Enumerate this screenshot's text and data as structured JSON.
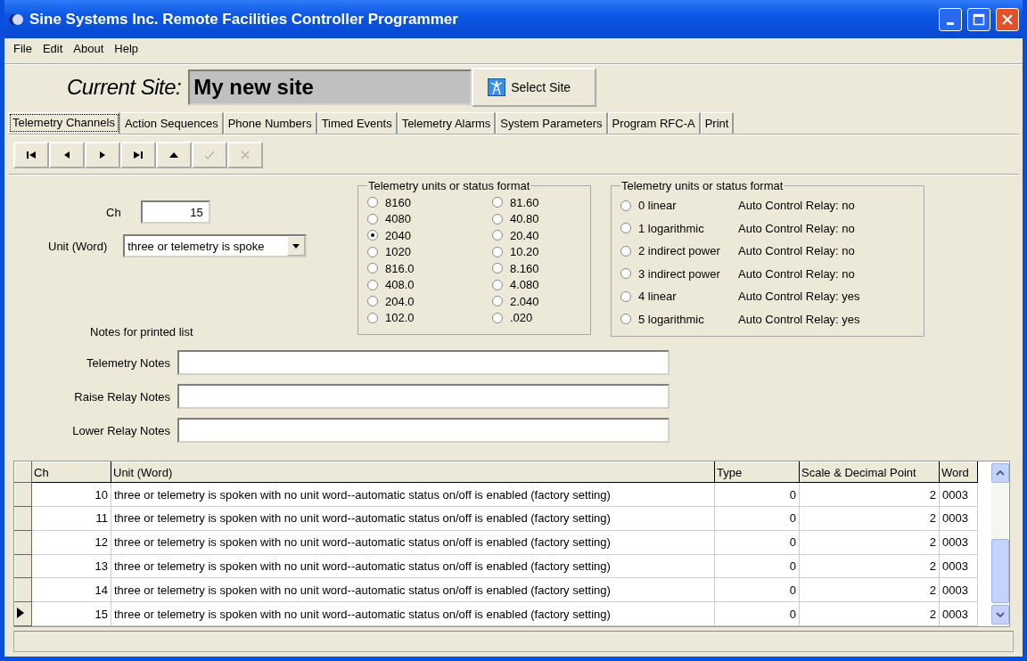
{
  "window": {
    "title": "Sine Systems Inc. Remote Facilities Controller Programmer"
  },
  "menu": [
    "File",
    "Edit",
    "About",
    "Help"
  ],
  "site": {
    "label": "Current Site:",
    "value": "My new site",
    "button": "Select Site"
  },
  "tabs": [
    {
      "label": "Telemetry Channels",
      "selected": true
    },
    {
      "label": "Action Sequences",
      "selected": false
    },
    {
      "label": "Phone Numbers",
      "selected": false
    },
    {
      "label": "Timed Events",
      "selected": false
    },
    {
      "label": "Telemetry Alarms",
      "selected": false
    },
    {
      "label": "System Parameters",
      "selected": false
    },
    {
      "label": "Program RFC-A",
      "selected": false
    },
    {
      "label": "Print",
      "selected": false
    }
  ],
  "toolbar": [
    {
      "kind": "first",
      "disabled": false
    },
    {
      "kind": "prev",
      "disabled": false
    },
    {
      "kind": "next",
      "disabled": false
    },
    {
      "kind": "last",
      "disabled": false
    },
    {
      "kind": "up",
      "disabled": false
    },
    {
      "kind": "post",
      "disabled": true
    },
    {
      "kind": "cancel",
      "disabled": true
    }
  ],
  "form": {
    "ch_label": "Ch",
    "ch_value": "15",
    "unit_label": "Unit (Word)",
    "unit_value": "three or telemetry is spoke",
    "notes_heading": "Notes for printed list",
    "notes": [
      {
        "label": "Telemetry Notes"
      },
      {
        "label": "Raise Relay Notes"
      },
      {
        "label": "Lower Relay Notes"
      }
    ]
  },
  "scale_group": {
    "title": "Telemetry units or status format",
    "options": [
      {
        "label": "8160",
        "selected": false
      },
      {
        "label": "4080",
        "selected": false
      },
      {
        "label": "2040",
        "selected": true
      },
      {
        "label": "1020",
        "selected": false
      },
      {
        "label": "816.0",
        "selected": false
      },
      {
        "label": "408.0",
        "selected": false
      },
      {
        "label": "204.0",
        "selected": false
      },
      {
        "label": "102.0",
        "selected": false
      },
      {
        "label": "81.60",
        "selected": false
      },
      {
        "label": "40.80",
        "selected": false
      },
      {
        "label": "20.40",
        "selected": false
      },
      {
        "label": "10.20",
        "selected": false
      },
      {
        "label": "8.160",
        "selected": false
      },
      {
        "label": "4.080",
        "selected": false
      },
      {
        "label": "2.040",
        "selected": false
      },
      {
        "label": ".020",
        "selected": false
      }
    ]
  },
  "type_group": {
    "title": "Telemetry units or status format",
    "options": [
      {
        "label": "0 linear",
        "relay": "Auto Control Relay:  no",
        "selected": false
      },
      {
        "label": "1 logarithmic",
        "relay": "Auto Control Relay:  no",
        "selected": false
      },
      {
        "label": "2 indirect power",
        "relay": "Auto Control Relay:  no",
        "selected": false
      },
      {
        "label": "3 indirect power",
        "relay": "Auto Control Relay:  no",
        "selected": false
      },
      {
        "label": "4 linear",
        "relay": "Auto Control Relay:  yes",
        "selected": false
      },
      {
        "label": "5 logarithmic",
        "relay": "Auto Control Relay:  yes",
        "selected": false
      }
    ]
  },
  "table": {
    "columns": [
      "Ch",
      "Unit (Word)",
      "Type",
      "Scale & Decimal Point",
      "Word"
    ],
    "rows": [
      {
        "cells": [
          "10",
          "three or telemetry is spoken with no unit word--automatic status on/off is enabled (factory setting)",
          "0",
          "2",
          "0003"
        ],
        "selected": false
      },
      {
        "cells": [
          "11",
          "three or telemetry is spoken with no unit word--automatic status on/off is enabled (factory setting)",
          "0",
          "2",
          "0003"
        ],
        "selected": false
      },
      {
        "cells": [
          "12",
          "three or telemetry is spoken with no unit word--automatic status on/off is enabled (factory setting)",
          "0",
          "2",
          "0003"
        ],
        "selected": false
      },
      {
        "cells": [
          "13",
          "three or telemetry is spoken with no unit word--automatic status on/off is enabled (factory setting)",
          "0",
          "2",
          "0003"
        ],
        "selected": false
      },
      {
        "cells": [
          "14",
          "three or telemetry is spoken with no unit word--automatic status on/off is enabled (factory setting)",
          "0",
          "2",
          "0003"
        ],
        "selected": false
      },
      {
        "cells": [
          "15",
          "three or telemetry is spoken with no unit word--automatic status on/off is enabled (factory setting)",
          "0",
          "2",
          "0003"
        ],
        "selected": true
      }
    ]
  }
}
